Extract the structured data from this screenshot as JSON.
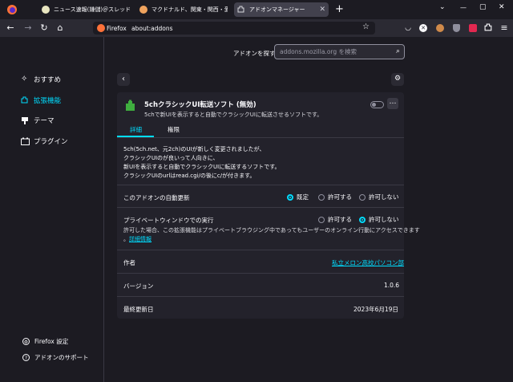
{
  "tabs": [
    {
      "title": "ニュース速報(嫌儲)＠スレッド一覧 - 5ch",
      "favicon_color": "#e8e5c0"
    },
    {
      "title": "マクドナルド、関東・関西・愛知で仕",
      "favicon_color": "#f0a35e"
    },
    {
      "title": "アドオンマネージャー",
      "favicon_color": "#dadade"
    }
  ],
  "new_tab": "+",
  "window_controls": {
    "minimize": "—",
    "maximize": "▢",
    "close": "✕"
  },
  "url": {
    "identity": "Firefox",
    "address": "about:addons"
  },
  "search": {
    "label": "アドオンを探す",
    "placeholder": "addons.mozilla.org を検索"
  },
  "sidebar": {
    "categories": [
      {
        "label": "おすすめ",
        "icon": "sparkle-icon"
      },
      {
        "label": "拡張機能",
        "icon": "puzzle-icon"
      },
      {
        "label": "テーマ",
        "icon": "brush-icon"
      },
      {
        "label": "プラグイン",
        "icon": "plugin-icon"
      }
    ],
    "footer": [
      {
        "label": "Firefox 設定",
        "icon": "gear-icon"
      },
      {
        "label": "アドオンのサポート",
        "icon": "help-icon"
      }
    ]
  },
  "addon": {
    "name": "5chクラシックUI転送ソフト (無効)",
    "summary": "5chで新UIを表示すると自動でクラシックUIに転送させるソフトです。",
    "tabs": [
      "詳細",
      "権限"
    ],
    "description": [
      "5ch(5ch.net、元2ch)のUIが新しく変更されましたが、",
      "クラシックUIのが良いって人向きに、",
      "新UIを表示すると自動でクラシックUIに転送するソフトです。",
      "クラシックUIのurlはread.cgi/の後にc/が付きます。"
    ],
    "auto_update": {
      "label": "このアドオンの自動更新",
      "options": [
        "既定",
        "許可する",
        "許可しない"
      ],
      "selected": "既定"
    },
    "private": {
      "label": "プライベートウィンドウでの実行",
      "options": [
        "許可する",
        "許可しない"
      ],
      "selected": "許可しない",
      "note_line1": "許可した場合、この拡張機能はプライベートブラウジング中であってもユーザーのオンライン行動にアクセスできます",
      "note_line2_prefix": "。",
      "details_link": "詳細情報"
    },
    "author_label": "作者",
    "author": "私立メロン高校パソコン部",
    "version_label": "バージョン",
    "version": "1.0.6",
    "updated_label": "最終更新日",
    "updated": "2023年6月19日",
    "enabled": false
  },
  "colors": {
    "accent": "#00ddff",
    "link": "#00ddff",
    "bg": "#1c1b22",
    "card": "#23222b"
  }
}
